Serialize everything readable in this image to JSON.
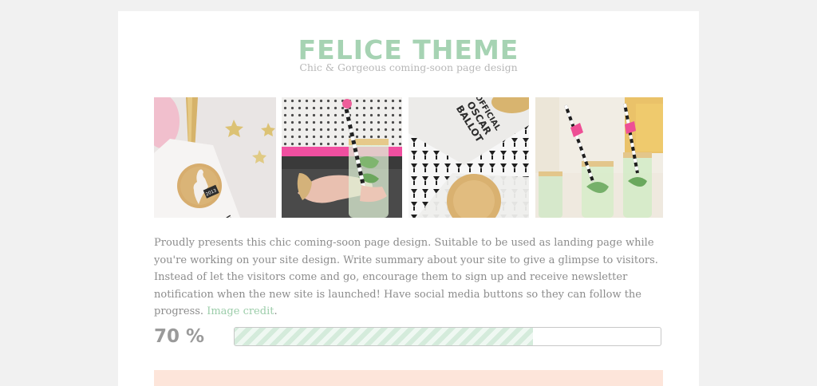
{
  "header": {
    "title": "FELICE THEME",
    "tagline": "Chic & Gorgeous coming-soon page design"
  },
  "gallery": [
    {
      "subject": "glitter party tag with ribbon and gold stars"
    },
    {
      "subject": "hand holding cocktail glass with striped straw"
    },
    {
      "subject": "official Oscar ballot card with glitter medallion"
    },
    {
      "subject": "cocktail glasses with striped straws and pink tassels"
    }
  ],
  "photo_text": {
    "tag_year": "2013",
    "ballot_line1": "OFFICIAL",
    "ballot_line2": "OSCAR",
    "ballot_line3": "BALLOT"
  },
  "intro": {
    "body": "Proudly presents this chic coming-soon page design. Suitable to be used as landing page while you're working on your site design. Write summary about your site to give a glimpse to visitors. Instead of let the visitors come and go, encourage them to sign up and receive newsletter notification when the new site is launched! Have social media buttons so they can follow the progress. ",
    "link_label": "Image credit",
    "trailing": "."
  },
  "progress": {
    "label": "70 %",
    "value": 0.7
  },
  "colors": {
    "accent": "#a6d3b3",
    "link": "#9ccdaa",
    "panel": "#fde5da"
  }
}
